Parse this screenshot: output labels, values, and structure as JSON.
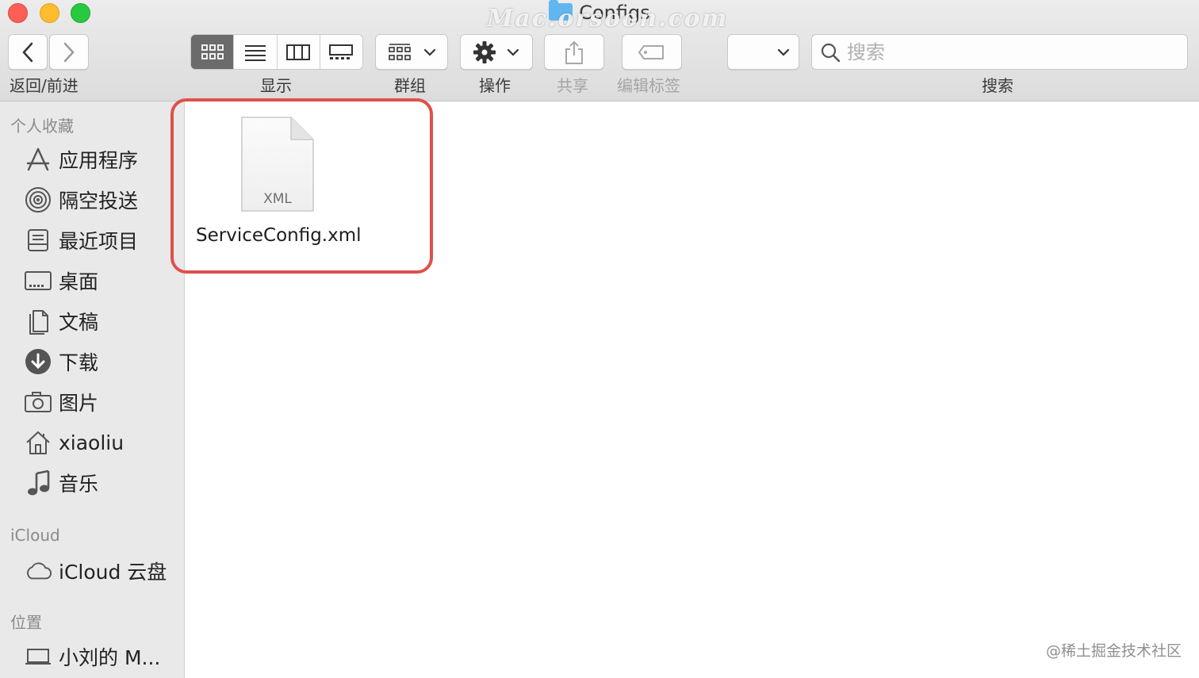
{
  "window": {
    "title": "Configs",
    "watermark": "Mac.orsoon.com"
  },
  "toolbar": {
    "nav_label": "返回/前进",
    "view_label": "显示",
    "group_label": "群组",
    "action_label": "操作",
    "share_label": "共享",
    "tags_label": "编辑标签",
    "search_label": "搜索",
    "search_placeholder": "搜索",
    "active_view": "icon"
  },
  "sidebar": {
    "favorites_title": "个人收藏",
    "favorites": [
      {
        "label": "应用程序",
        "icon": "applications-icon"
      },
      {
        "label": "隔空投送",
        "icon": "airdrop-icon"
      },
      {
        "label": "最近项目",
        "icon": "recents-icon"
      },
      {
        "label": "桌面",
        "icon": "desktop-icon"
      },
      {
        "label": "文稿",
        "icon": "documents-icon"
      },
      {
        "label": "下载",
        "icon": "downloads-icon"
      },
      {
        "label": "图片",
        "icon": "pictures-icon"
      },
      {
        "label": "xiaoliu",
        "icon": "home-icon"
      },
      {
        "label": "音乐",
        "icon": "music-icon"
      }
    ],
    "icloud_title": "iCloud",
    "icloud": [
      {
        "label": "iCloud 云盘",
        "icon": "cloud-icon"
      }
    ],
    "locations_title": "位置",
    "locations": [
      {
        "label": "小刘的 M...",
        "icon": "computer-icon"
      }
    ]
  },
  "files": [
    {
      "name": "ServiceConfig.xml",
      "type_label": "XML",
      "selected": true
    }
  ],
  "footer": {
    "watermark": "@稀土掘金技术社区"
  },
  "colors": {
    "highlight": "#e0504a",
    "active_segment": "#6b6b6b"
  }
}
